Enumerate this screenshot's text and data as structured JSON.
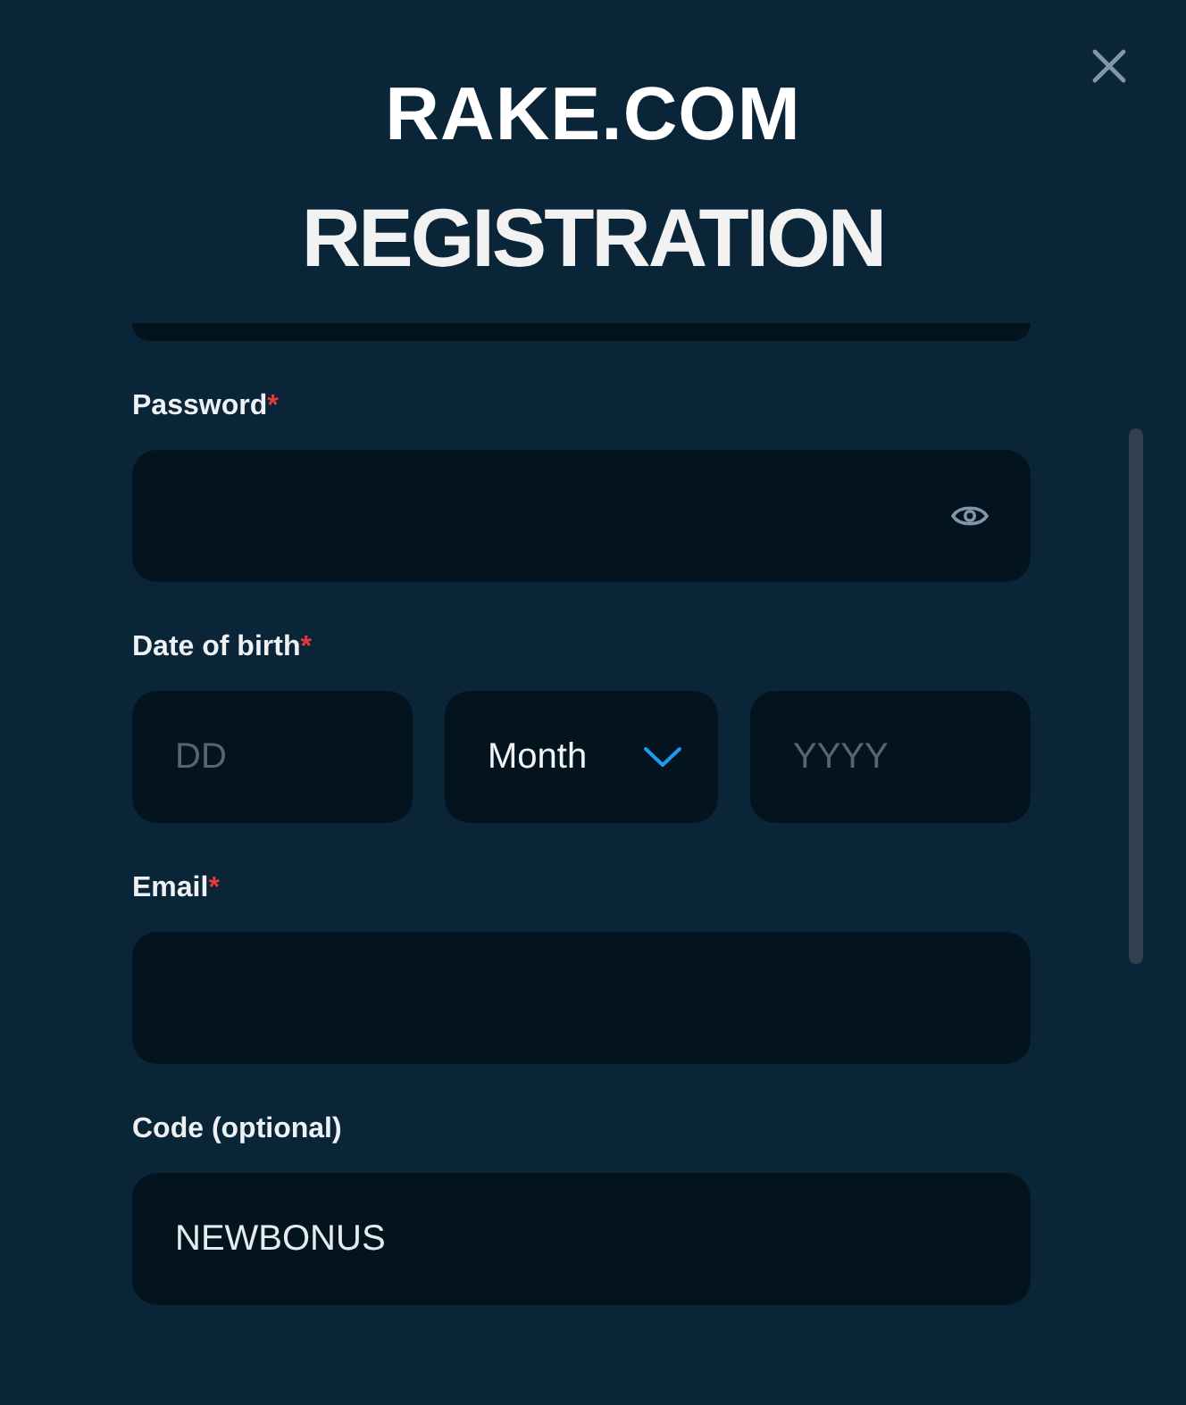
{
  "dialog": {
    "logo": "RAKE.COM",
    "title": "REGISTRATION"
  },
  "fields": [
    {
      "kind": "clipped"
    },
    {
      "kind": "password",
      "label": "Password",
      "required_mark": "*"
    },
    {
      "kind": "date",
      "label": "Date of birth",
      "required_mark": "*",
      "parts": [
        {
          "kind": "input",
          "placeholder": "DD"
        },
        {
          "kind": "select",
          "value": "Month"
        },
        {
          "kind": "input",
          "placeholder": "YYYY"
        }
      ]
    },
    {
      "kind": "text",
      "label": "Email",
      "required_mark": "*"
    },
    {
      "kind": "text",
      "label": "Code (optional)",
      "value": "NEWBONUS"
    }
  ]
}
